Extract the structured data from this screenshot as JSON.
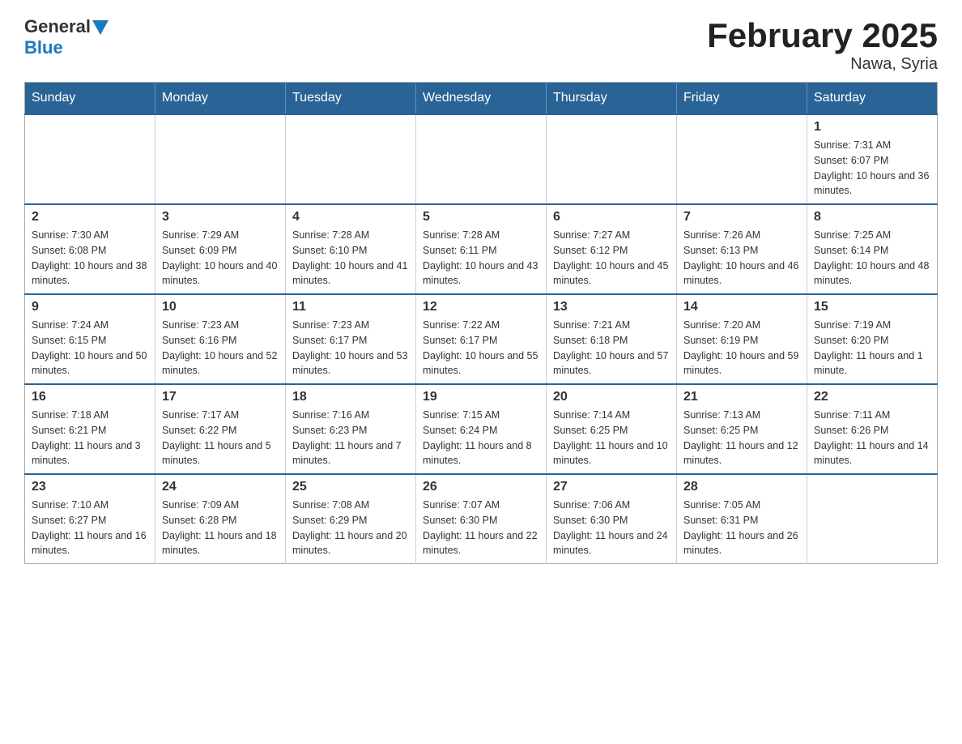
{
  "header": {
    "logo_general": "General",
    "logo_blue": "Blue",
    "title": "February 2025",
    "subtitle": "Nawa, Syria"
  },
  "weekdays": [
    "Sunday",
    "Monday",
    "Tuesday",
    "Wednesday",
    "Thursday",
    "Friday",
    "Saturday"
  ],
  "weeks": [
    [
      {
        "day": "",
        "info": ""
      },
      {
        "day": "",
        "info": ""
      },
      {
        "day": "",
        "info": ""
      },
      {
        "day": "",
        "info": ""
      },
      {
        "day": "",
        "info": ""
      },
      {
        "day": "",
        "info": ""
      },
      {
        "day": "1",
        "info": "Sunrise: 7:31 AM\nSunset: 6:07 PM\nDaylight: 10 hours and 36 minutes."
      }
    ],
    [
      {
        "day": "2",
        "info": "Sunrise: 7:30 AM\nSunset: 6:08 PM\nDaylight: 10 hours and 38 minutes."
      },
      {
        "day": "3",
        "info": "Sunrise: 7:29 AM\nSunset: 6:09 PM\nDaylight: 10 hours and 40 minutes."
      },
      {
        "day": "4",
        "info": "Sunrise: 7:28 AM\nSunset: 6:10 PM\nDaylight: 10 hours and 41 minutes."
      },
      {
        "day": "5",
        "info": "Sunrise: 7:28 AM\nSunset: 6:11 PM\nDaylight: 10 hours and 43 minutes."
      },
      {
        "day": "6",
        "info": "Sunrise: 7:27 AM\nSunset: 6:12 PM\nDaylight: 10 hours and 45 minutes."
      },
      {
        "day": "7",
        "info": "Sunrise: 7:26 AM\nSunset: 6:13 PM\nDaylight: 10 hours and 46 minutes."
      },
      {
        "day": "8",
        "info": "Sunrise: 7:25 AM\nSunset: 6:14 PM\nDaylight: 10 hours and 48 minutes."
      }
    ],
    [
      {
        "day": "9",
        "info": "Sunrise: 7:24 AM\nSunset: 6:15 PM\nDaylight: 10 hours and 50 minutes."
      },
      {
        "day": "10",
        "info": "Sunrise: 7:23 AM\nSunset: 6:16 PM\nDaylight: 10 hours and 52 minutes."
      },
      {
        "day": "11",
        "info": "Sunrise: 7:23 AM\nSunset: 6:17 PM\nDaylight: 10 hours and 53 minutes."
      },
      {
        "day": "12",
        "info": "Sunrise: 7:22 AM\nSunset: 6:17 PM\nDaylight: 10 hours and 55 minutes."
      },
      {
        "day": "13",
        "info": "Sunrise: 7:21 AM\nSunset: 6:18 PM\nDaylight: 10 hours and 57 minutes."
      },
      {
        "day": "14",
        "info": "Sunrise: 7:20 AM\nSunset: 6:19 PM\nDaylight: 10 hours and 59 minutes."
      },
      {
        "day": "15",
        "info": "Sunrise: 7:19 AM\nSunset: 6:20 PM\nDaylight: 11 hours and 1 minute."
      }
    ],
    [
      {
        "day": "16",
        "info": "Sunrise: 7:18 AM\nSunset: 6:21 PM\nDaylight: 11 hours and 3 minutes."
      },
      {
        "day": "17",
        "info": "Sunrise: 7:17 AM\nSunset: 6:22 PM\nDaylight: 11 hours and 5 minutes."
      },
      {
        "day": "18",
        "info": "Sunrise: 7:16 AM\nSunset: 6:23 PM\nDaylight: 11 hours and 7 minutes."
      },
      {
        "day": "19",
        "info": "Sunrise: 7:15 AM\nSunset: 6:24 PM\nDaylight: 11 hours and 8 minutes."
      },
      {
        "day": "20",
        "info": "Sunrise: 7:14 AM\nSunset: 6:25 PM\nDaylight: 11 hours and 10 minutes."
      },
      {
        "day": "21",
        "info": "Sunrise: 7:13 AM\nSunset: 6:25 PM\nDaylight: 11 hours and 12 minutes."
      },
      {
        "day": "22",
        "info": "Sunrise: 7:11 AM\nSunset: 6:26 PM\nDaylight: 11 hours and 14 minutes."
      }
    ],
    [
      {
        "day": "23",
        "info": "Sunrise: 7:10 AM\nSunset: 6:27 PM\nDaylight: 11 hours and 16 minutes."
      },
      {
        "day": "24",
        "info": "Sunrise: 7:09 AM\nSunset: 6:28 PM\nDaylight: 11 hours and 18 minutes."
      },
      {
        "day": "25",
        "info": "Sunrise: 7:08 AM\nSunset: 6:29 PM\nDaylight: 11 hours and 20 minutes."
      },
      {
        "day": "26",
        "info": "Sunrise: 7:07 AM\nSunset: 6:30 PM\nDaylight: 11 hours and 22 minutes."
      },
      {
        "day": "27",
        "info": "Sunrise: 7:06 AM\nSunset: 6:30 PM\nDaylight: 11 hours and 24 minutes."
      },
      {
        "day": "28",
        "info": "Sunrise: 7:05 AM\nSunset: 6:31 PM\nDaylight: 11 hours and 26 minutes."
      },
      {
        "day": "",
        "info": ""
      }
    ]
  ]
}
